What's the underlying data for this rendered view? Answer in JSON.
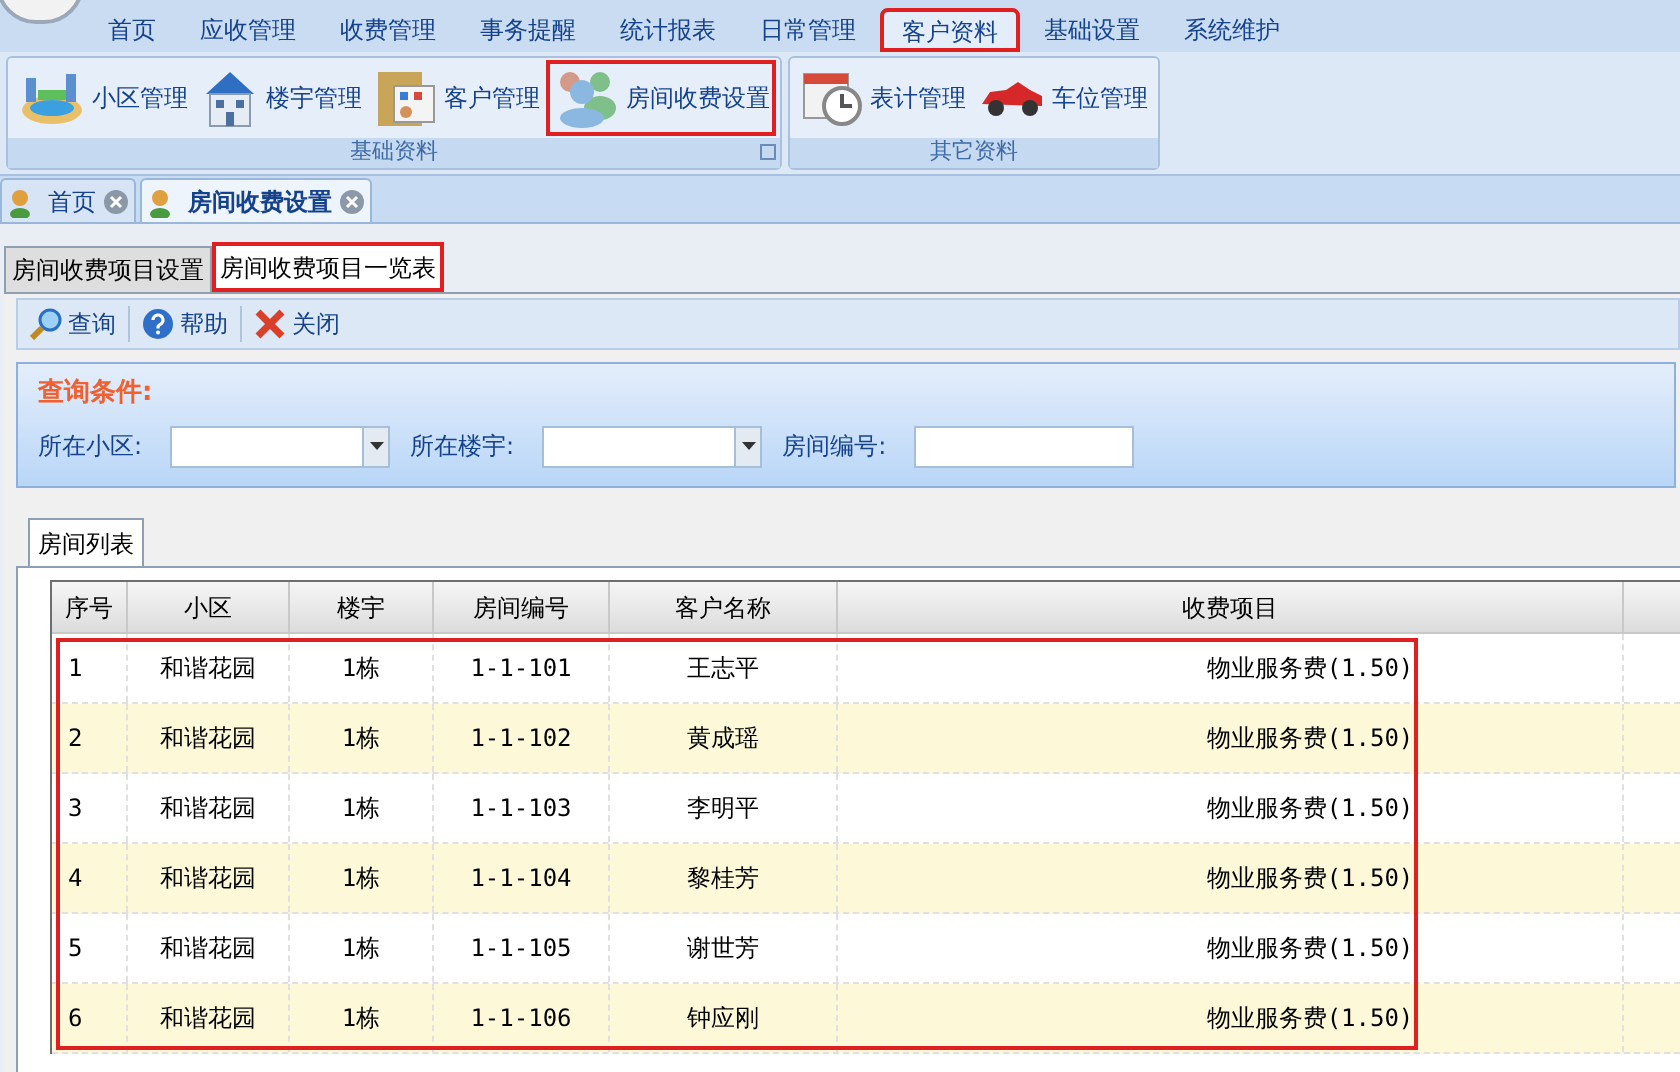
{
  "menu": [
    {
      "label": "首页",
      "selected": false,
      "highlighted": false
    },
    {
      "label": "应收管理",
      "selected": false,
      "highlighted": false
    },
    {
      "label": "收费管理",
      "selected": false,
      "highlighted": false
    },
    {
      "label": "事务提醒",
      "selected": false,
      "highlighted": false
    },
    {
      "label": "统计报表",
      "selected": false,
      "highlighted": false
    },
    {
      "label": "日常管理",
      "selected": false,
      "highlighted": false
    },
    {
      "label": "客户资料",
      "selected": true,
      "highlighted": true
    },
    {
      "label": "基础设置",
      "selected": false,
      "highlighted": false
    },
    {
      "label": "系统维护",
      "selected": false,
      "highlighted": false
    }
  ],
  "ribbon_groups": [
    {
      "title": "基础资料",
      "buttons": [
        {
          "label": "小区管理",
          "kind": "pool",
          "highlighted": false
        },
        {
          "label": "楼宇管理",
          "kind": "building",
          "highlighted": false
        },
        {
          "label": "客户管理",
          "kind": "folder",
          "highlighted": false
        },
        {
          "label": "房间收费设置",
          "kind": "people",
          "highlighted": true
        }
      ]
    },
    {
      "title": "其它资料",
      "buttons": [
        {
          "label": "表计管理",
          "kind": "clock",
          "highlighted": false
        },
        {
          "label": "车位管理",
          "kind": "car",
          "highlighted": false
        }
      ]
    }
  ],
  "doc_tabs": [
    {
      "label": "首页",
      "selected": false
    },
    {
      "label": "房间收费设置",
      "selected": true
    }
  ],
  "sub_tabs": [
    {
      "label": "房间收费项目设置",
      "selected": false,
      "highlighted": false
    },
    {
      "label": "房间收费项目一览表",
      "selected": true,
      "highlighted": true
    }
  ],
  "toolbar": [
    {
      "label": "查询",
      "kind": "search"
    },
    {
      "label": "帮助",
      "kind": "help"
    },
    {
      "label": "关闭",
      "kind": "close"
    }
  ],
  "query": {
    "title": "查询条件:",
    "fields": [
      {
        "label": "所在小区:",
        "kind": "dropdown"
      },
      {
        "label": "所在楼宇:",
        "kind": "dropdown"
      },
      {
        "label": "房间编号:",
        "kind": "text"
      }
    ]
  },
  "list_tab": "房间列表",
  "table": {
    "columns": [
      "序号",
      "小区",
      "楼宇",
      "房间编号",
      "客户名称",
      "收费项目"
    ],
    "highlighted": true,
    "rows": [
      [
        "1",
        "和谐花园",
        "1栋",
        "1-1-101",
        "王志平",
        "物业服务费(1.50)"
      ],
      [
        "2",
        "和谐花园",
        "1栋",
        "1-1-102",
        "黄成瑶",
        "物业服务费(1.50)"
      ],
      [
        "3",
        "和谐花园",
        "1栋",
        "1-1-103",
        "李明平",
        "物业服务费(1.50)"
      ],
      [
        "4",
        "和谐花园",
        "1栋",
        "1-1-104",
        "黎桂芳",
        "物业服务费(1.50)"
      ],
      [
        "5",
        "和谐花园",
        "1栋",
        "1-1-105",
        "谢世芳",
        "物业服务费(1.50)"
      ],
      [
        "6",
        "和谐花园",
        "1栋",
        "1-1-106",
        "钟应刚",
        "物业服务费(1.50)"
      ]
    ]
  }
}
